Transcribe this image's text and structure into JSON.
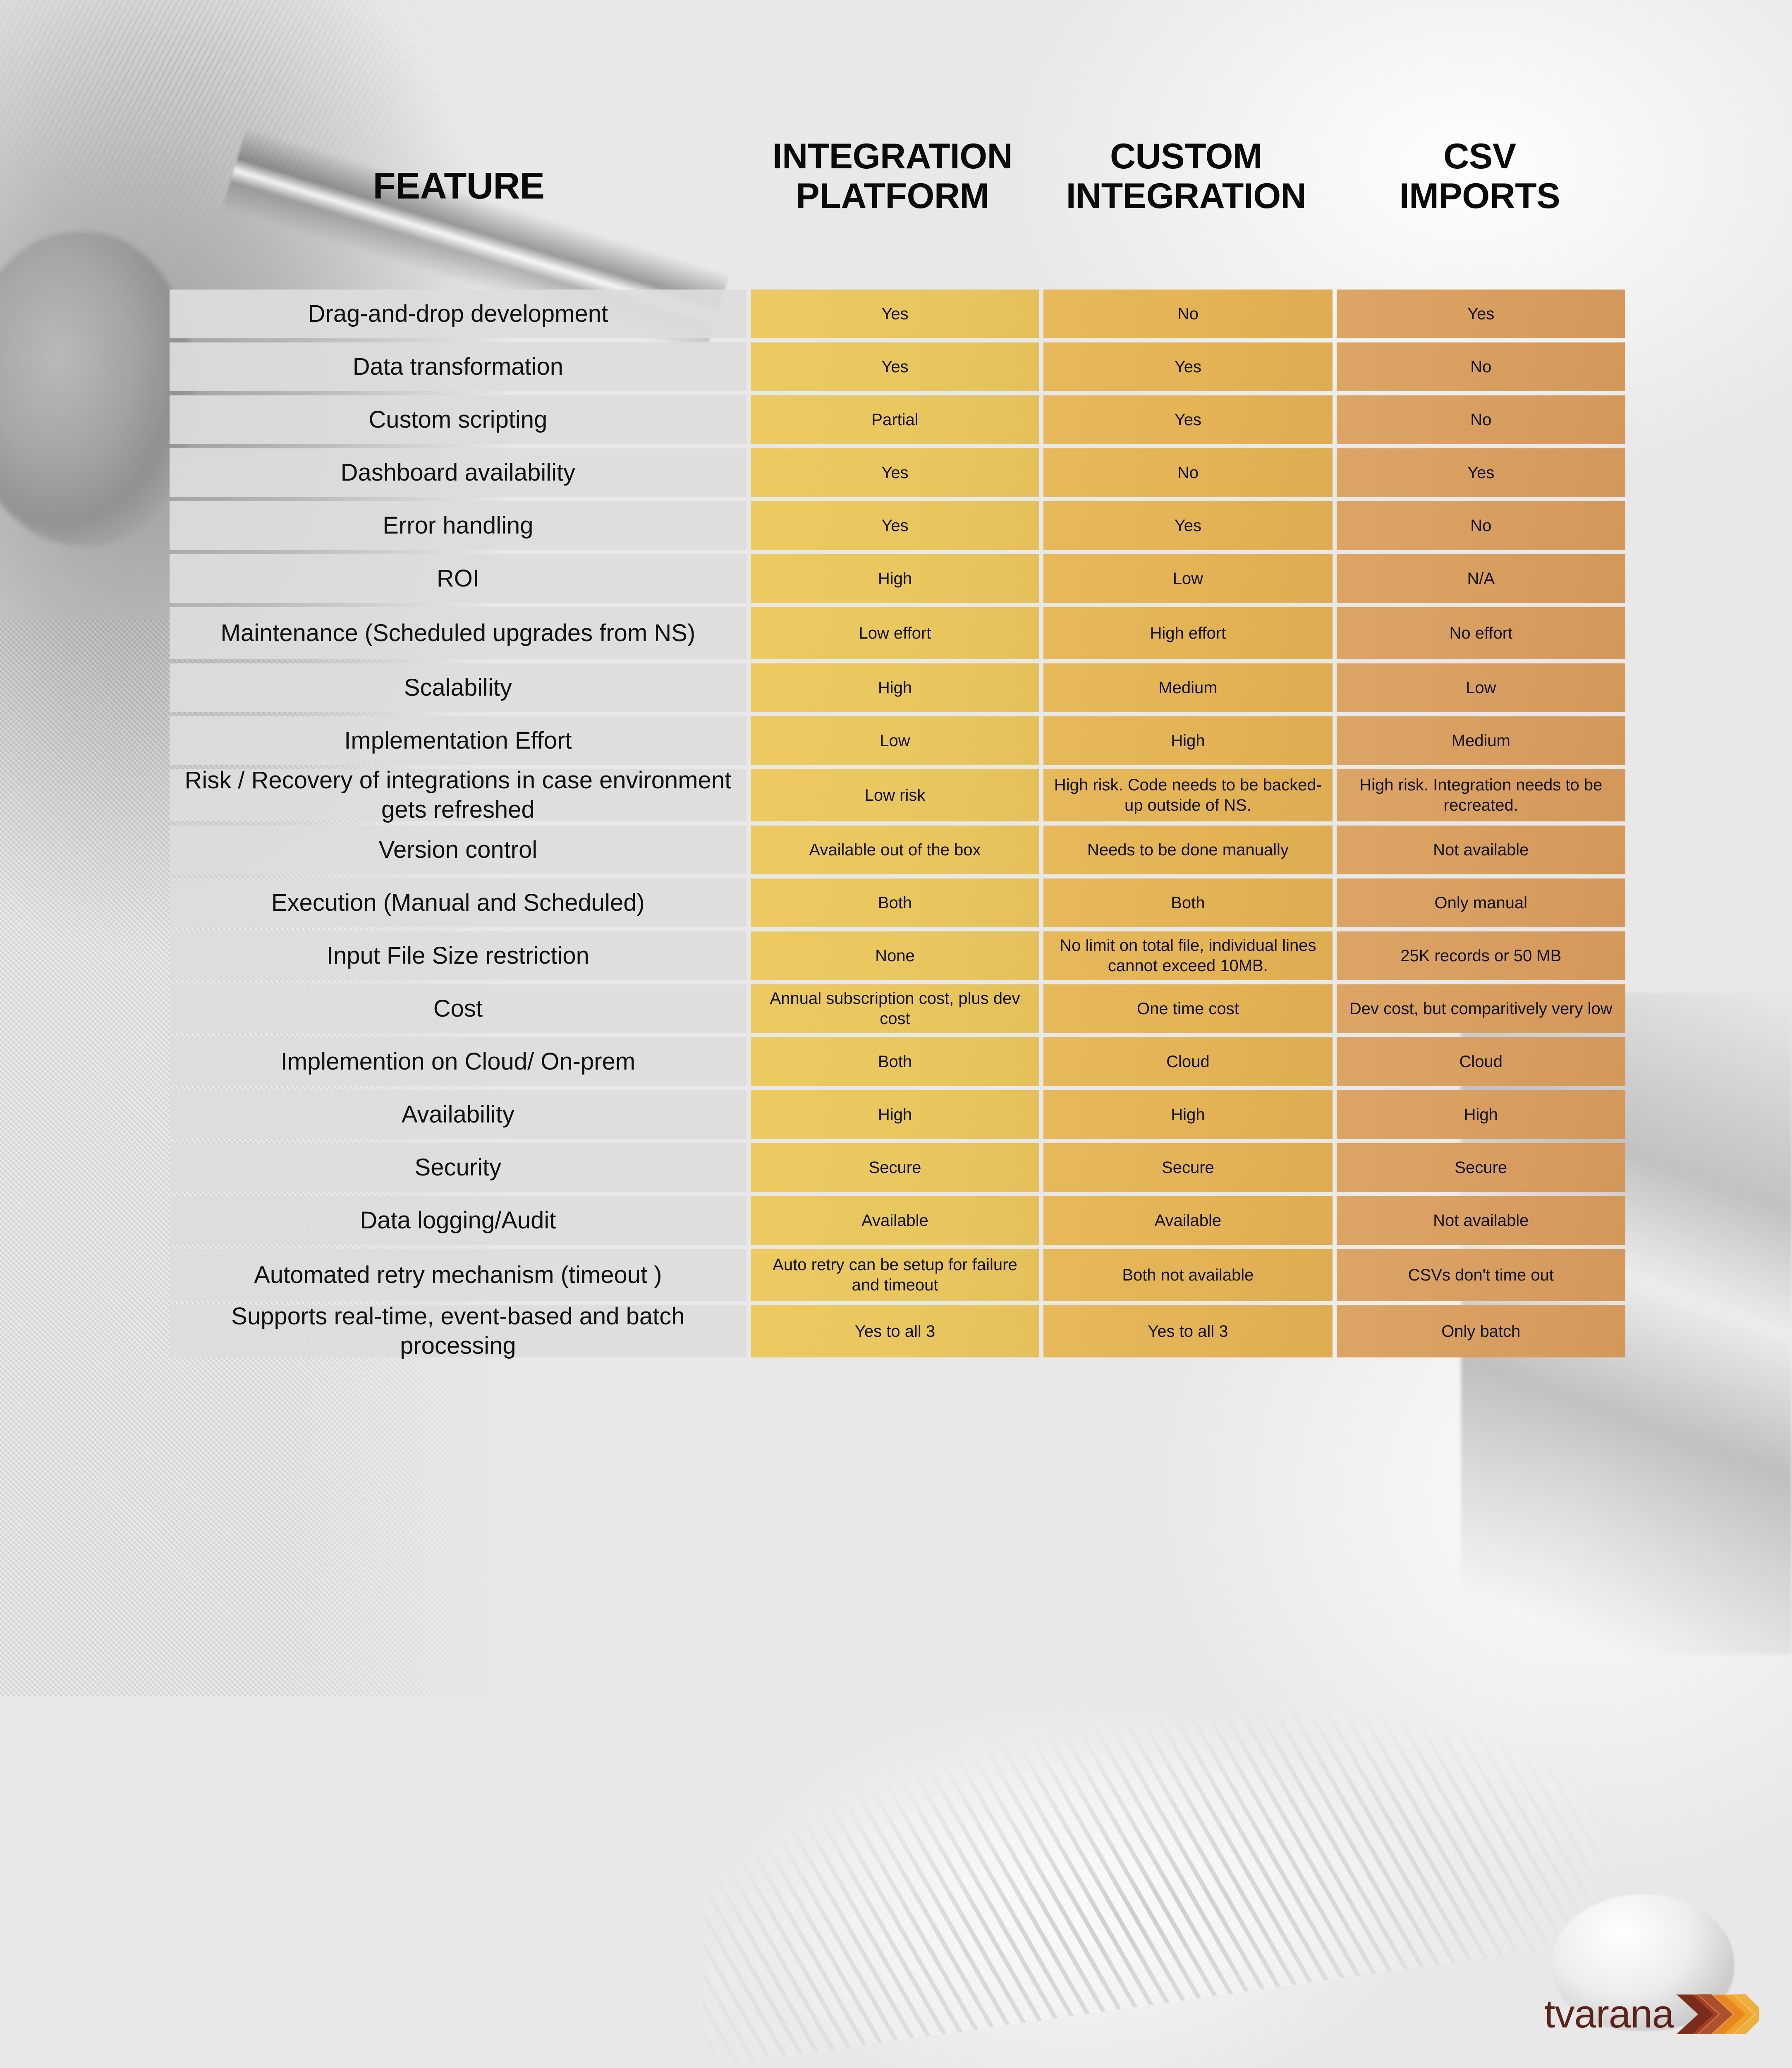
{
  "headers": {
    "feature": "FEATURE",
    "col1_line1": "INTEGRATION",
    "col1_line2": "PLATFORM",
    "col2_line1": "CUSTOM",
    "col2_line2": "INTEGRATION",
    "col3_line1": "CSV",
    "col3_line2": "IMPORTS"
  },
  "colors": {
    "col1": "#ecca61",
    "col2": "#e7b95a",
    "col3": "#dca565",
    "feature_cell": "#dddddd",
    "logo_word": "#5c2318",
    "logo_mark_dark": "#7a2b1c",
    "logo_mark_orange": "#e8871f",
    "logo_mark_gold": "#f0a92c"
  },
  "logo": {
    "word": "tvarana",
    "mark": "double-chevron"
  },
  "chart_data": {
    "type": "table",
    "title": "Integration approach comparison",
    "columns": [
      "FEATURE",
      "INTEGRATION PLATFORM",
      "CUSTOM INTEGRATION",
      "CSV IMPORTS"
    ],
    "rows": [
      {
        "feature": "Drag-and-drop development",
        "v1": "Yes",
        "v2": "No",
        "v3": "Yes"
      },
      {
        "feature": "Data transformation",
        "v1": "Yes",
        "v2": "Yes",
        "v3": "No"
      },
      {
        "feature": "Custom scripting",
        "v1": "Partial",
        "v2": "Yes",
        "v3": "No"
      },
      {
        "feature": "Dashboard availability",
        "v1": "Yes",
        "v2": "No",
        "v3": "Yes"
      },
      {
        "feature": "Error handling",
        "v1": "Yes",
        "v2": "Yes",
        "v3": "No"
      },
      {
        "feature": "ROI",
        "v1": "High",
        "v2": "Low",
        "v3": "N/A"
      },
      {
        "feature": "Maintenance (Scheduled upgrades from NS)",
        "v1": "Low effort",
        "v2": "High effort",
        "v3": "No effort"
      },
      {
        "feature": "Scalability",
        "v1": "High",
        "v2": "Medium",
        "v3": "Low"
      },
      {
        "feature": "Implementation Effort",
        "v1": "Low",
        "v2": "High",
        "v3": "Medium"
      },
      {
        "feature": "Risk / Recovery of integrations in case environment gets refreshed",
        "v1": "Low risk",
        "v2": "High risk. Code needs to be backed-up outside of NS.",
        "v3": "High risk. Integration needs to be recreated."
      },
      {
        "feature": "Version control",
        "v1": "Available out of the box",
        "v2": "Needs to be done manually",
        "v3": "Not available"
      },
      {
        "feature": "Execution (Manual and Scheduled)",
        "v1": "Both",
        "v2": "Both",
        "v3": "Only manual"
      },
      {
        "feature": "Input File Size restriction",
        "v1": "None",
        "v2": "No limit on total file, individual lines cannot exceed 10MB.",
        "v3": "25K records or 50 MB"
      },
      {
        "feature": "Cost",
        "v1": "Annual subscription cost, plus dev cost",
        "v2": "One time cost",
        "v3": "Dev cost, but comparitively very low"
      },
      {
        "feature": "Implemention on Cloud/ On-prem",
        "v1": "Both",
        "v2": "Cloud",
        "v3": "Cloud"
      },
      {
        "feature": "Availability",
        "v1": "High",
        "v2": "High",
        "v3": "High"
      },
      {
        "feature": "Security",
        "v1": "Secure",
        "v2": "Secure",
        "v3": "Secure"
      },
      {
        "feature": "Data logging/Audit",
        "v1": "Available",
        "v2": "Available",
        "v3": "Not available"
      },
      {
        "feature": "Automated retry mechanism (timeout )",
        "v1": "Auto retry can be setup for failure and timeout",
        "v2": "Both not available",
        "v3": "CSVs don't time out"
      },
      {
        "feature": "Supports real-time, event-based and batch processing",
        "v1": "Yes to all 3",
        "v2": "Yes to all 3",
        "v3": "Only batch"
      }
    ]
  }
}
